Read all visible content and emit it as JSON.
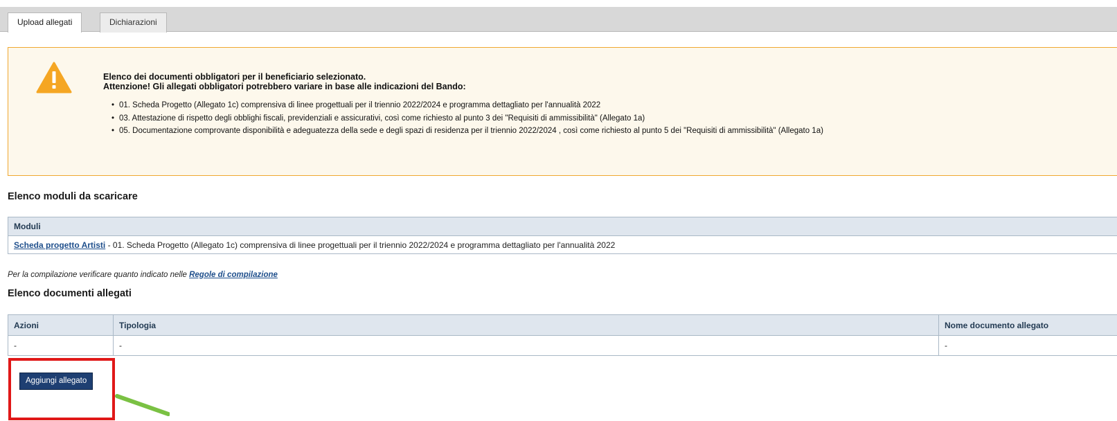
{
  "tabs": [
    {
      "label": "Upload allegati",
      "active": true
    },
    {
      "label": "Dichiarazioni",
      "active": false
    }
  ],
  "warning": {
    "icon": "warning-triangle-icon",
    "line1": "Elenco dei documenti obbligatori per il beneficiario selezionato.",
    "line2": "Attenzione! Gli allegati obbligatori potrebbero variare in base alle indicazioni del Bando:",
    "items": [
      "01. Scheda Progetto (Allegato 1c) comprensiva di linee progettuali per il triennio 2022/2024 e programma dettagliato per l'annualità 2022",
      "03. Attestazione di rispetto degli obblighi fiscali, previdenziali e assicurativi, così come richiesto al punto 3 dei \"Requisiti di ammissibilità\" (Allegato 1a)",
      "05. Documentazione comprovante disponibilità e adeguatezza della sede e degli spazi di residenza per il triennio 2022/2024 , così come richiesto al punto 5 dei \"Requisiti di ammissibilità\" (Allegato 1a)"
    ]
  },
  "moduli_section": {
    "title": "Elenco moduli da scaricare",
    "header": "Moduli",
    "row_link": "Scheda progetto Artisti",
    "row_text": " - 01. Scheda Progetto (Allegato 1c) comprensiva di linee progettuali per il triennio 2022/2024 e programma dettagliato per l'annualità 2022"
  },
  "hint": {
    "text": "Per la compilazione verificare quanto indicato nelle ",
    "link": "Regole di compilazione"
  },
  "documenti_section": {
    "title": "Elenco documenti allegati",
    "headers": [
      "Azioni",
      "Tipologia",
      "Nome documento allegato"
    ],
    "row": [
      "-",
      "-",
      "-"
    ]
  },
  "add_button": "Aggiungi allegato",
  "colors": {
    "warning_border": "#f0a830",
    "warning_icon": "#f5a623",
    "button_bg": "#1e3f72",
    "highlight": "#e01818",
    "arrow": "#7ac143"
  }
}
